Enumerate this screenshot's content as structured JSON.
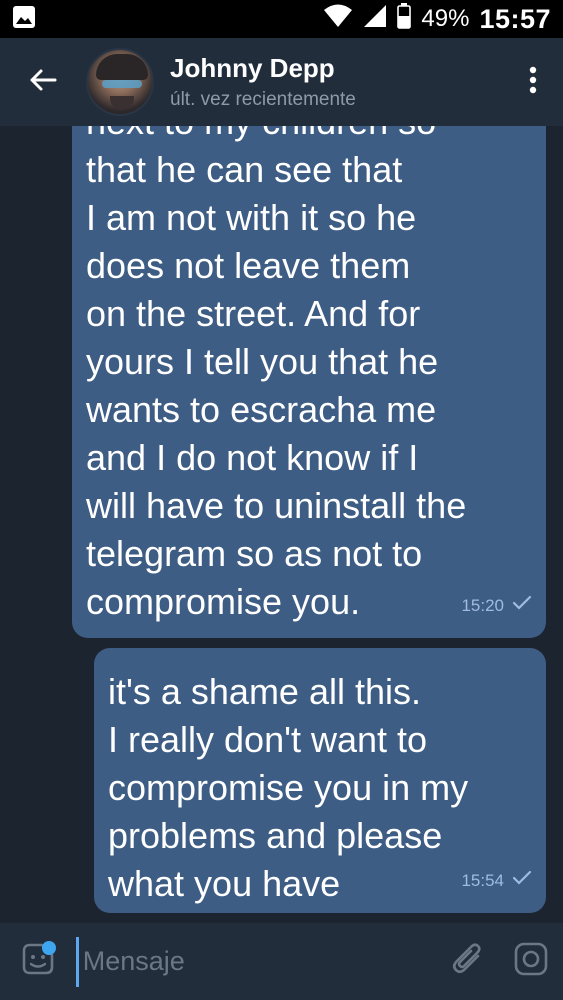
{
  "status_bar": {
    "notification_icon": "image-icon",
    "wifi_icon": "wifi-icon",
    "signal_icon": "signal-icon",
    "battery_icon": "battery-icon",
    "battery_percent": "49%",
    "time": "15:57"
  },
  "header": {
    "contact_name": "Johnny Depp",
    "contact_status": "últ. vez recientemente",
    "back_icon": "arrow-left-icon",
    "menu_icon": "more-vertical-icon"
  },
  "messages": [
    {
      "text": "next to my children so\nthat he can see that\nI am not with it so he\ndoes not leave them\non the street. And for\nyours I tell you that he\nwants to escracha me\nand I do not know if I\nwill have to uninstall the\ntelegram so as not to\ncompromise you.",
      "time": "15:20",
      "status_icon": "check-icon"
    },
    {
      "text": "it's a shame all this.\nI really don't want to\ncompromise you in my\nproblems and please\nwhat you have",
      "time": "15:54",
      "status_icon": "check-icon"
    }
  ],
  "input_bar": {
    "placeholder": "Mensaje",
    "value": "",
    "sticker_icon": "sticker-icon",
    "attach_icon": "paperclip-icon",
    "camera_icon": "camera-icon"
  },
  "colors": {
    "bubble": "#3e5d85",
    "header": "#212d3b",
    "background": "#1c242f",
    "accent": "#3ea6ee"
  }
}
